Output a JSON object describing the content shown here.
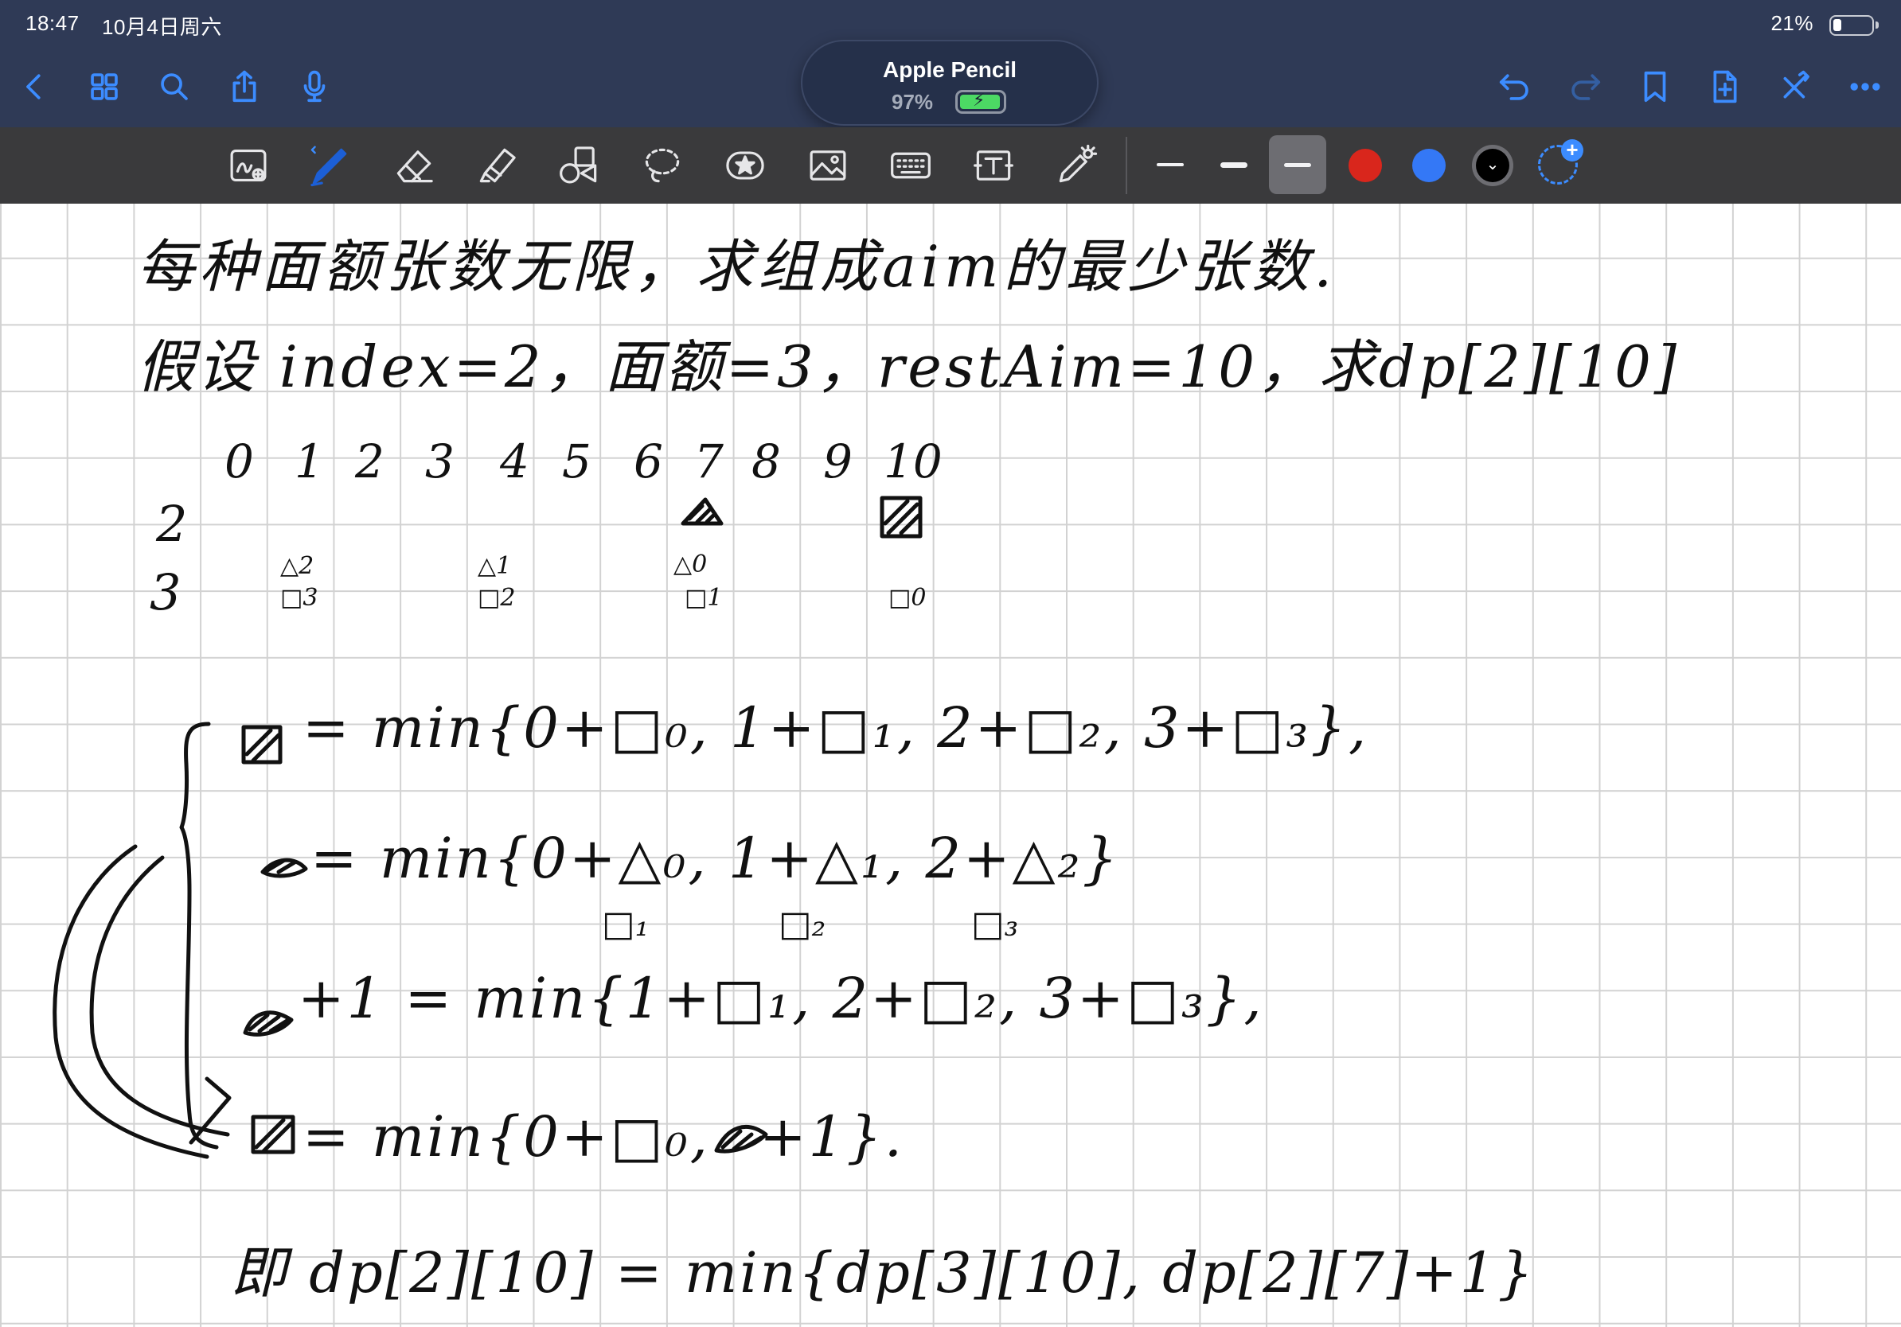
{
  "status_bar": {
    "time": "18:47",
    "date": "10月4日周六",
    "battery_percent": "21%",
    "battery_level": 0.21
  },
  "nav": {
    "icons": [
      "back-chevron-icon",
      "thumbnails-grid-icon",
      "search-icon",
      "share-icon",
      "microphone-icon",
      "undo-icon",
      "redo-icon",
      "bookmark-icon",
      "add-page-icon",
      "close-toolbar-icon",
      "more-icon"
    ],
    "accent_color": "#3c8cff",
    "bar_color": "#2f3a56"
  },
  "pencil_popup": {
    "title": "Apple Pencil",
    "level": "97%",
    "level_value": 0.97,
    "battery_color": "#4cd964"
  },
  "toolbar": {
    "tools": [
      "read-only-mode-icon",
      "pen-icon",
      "eraser-icon",
      "highlighter-icon",
      "shapes-icon",
      "lasso-icon",
      "elements-icon",
      "image-icon",
      "keyboard-icon",
      "text-icon",
      "laser-pointer-icon"
    ],
    "stroke_widths": [
      "thin",
      "medium",
      "thick"
    ],
    "selected_stroke_width": "thick",
    "colors": [
      "#d9261c",
      "#3478f6",
      "#000000"
    ],
    "selected_color": "#000000"
  },
  "note": {
    "line1": "每种面额张数无限，求组成aim的最少张数.",
    "line2": "假设 index=2，面额=3，restAim=10，求dp[2][10]",
    "column_indices": [
      "0",
      "1",
      "2",
      "3",
      "4",
      "5",
      "6",
      "7",
      "8",
      "9",
      "10"
    ],
    "row_labels": [
      "2",
      "3"
    ],
    "row3_notes": [
      {
        "top": "△2",
        "bottom": "□3"
      },
      {
        "top": "△1",
        "bottom": "□2"
      },
      {
        "top": "△0",
        "bottom": "□1"
      },
      {
        "top": "",
        "bottom": "□0"
      }
    ],
    "eq1": "= min{0+□₀, 1+□₁, 2+□₂, 3+□₃},",
    "eq2": "= min{0+△₀, 1+△₁, 2+△₂}",
    "eq2_subs": [
      "□₁",
      "□₂",
      "□₃"
    ],
    "eq3": "+1 = min{1+□₁, 2+□₂, 3+□₃},",
    "eq4": "= min{0+□₀, ",
    "eq4_tail": "+1}.",
    "conclusion": "即 dp[2][10] = min{dp[3][10], dp[2][7]+1}"
  }
}
